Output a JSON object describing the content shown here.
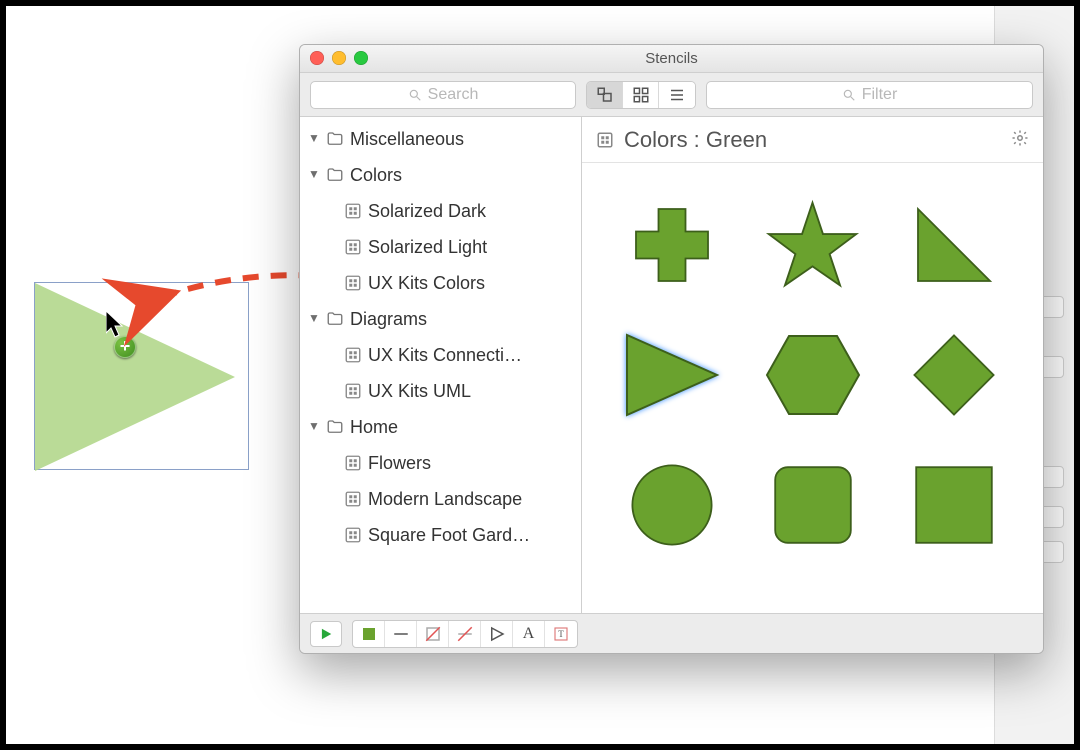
{
  "window": {
    "title": "Stencils"
  },
  "toolbar": {
    "search_placeholder": "Search",
    "filter_placeholder": "Filter",
    "view_modes": [
      "nested",
      "grid",
      "list"
    ]
  },
  "sidebar": {
    "items": [
      {
        "type": "folder",
        "level": 0,
        "expanded": true,
        "label": "Miscellaneous"
      },
      {
        "type": "folder",
        "level": 0,
        "expanded": true,
        "label": "Colors"
      },
      {
        "type": "stencil",
        "level": 1,
        "label": "Solarized Dark"
      },
      {
        "type": "stencil",
        "level": 1,
        "label": "Solarized Light"
      },
      {
        "type": "stencil",
        "level": 1,
        "label": "UX Kits Colors"
      },
      {
        "type": "folder",
        "level": 0,
        "expanded": true,
        "label": "Diagrams"
      },
      {
        "type": "stencil",
        "level": 1,
        "label": "UX Kits Connecti…"
      },
      {
        "type": "stencil",
        "level": 1,
        "label": "UX Kits UML"
      },
      {
        "type": "folder",
        "level": 0,
        "expanded": true,
        "label": "Home"
      },
      {
        "type": "stencil",
        "level": 1,
        "label": "Flowers"
      },
      {
        "type": "stencil",
        "level": 1,
        "label": "Modern Landscape"
      },
      {
        "type": "stencil",
        "level": 1,
        "label": "Square Foot Gard…"
      }
    ]
  },
  "content": {
    "title": "Colors : Green",
    "green": "#6aa22e",
    "stroke": "#3d5f1b",
    "shapes": [
      "cross",
      "star",
      "right-triangle",
      "play-triangle",
      "hexagon",
      "diamond",
      "circle",
      "rounded-square",
      "square"
    ],
    "selected_index": 3
  },
  "bottombar": {
    "tools": [
      "fill-square",
      "line",
      "no-fill",
      "no-stroke",
      "play-outline",
      "text-A",
      "text-frame"
    ]
  },
  "drag": {
    "cursor_label": "copy"
  }
}
